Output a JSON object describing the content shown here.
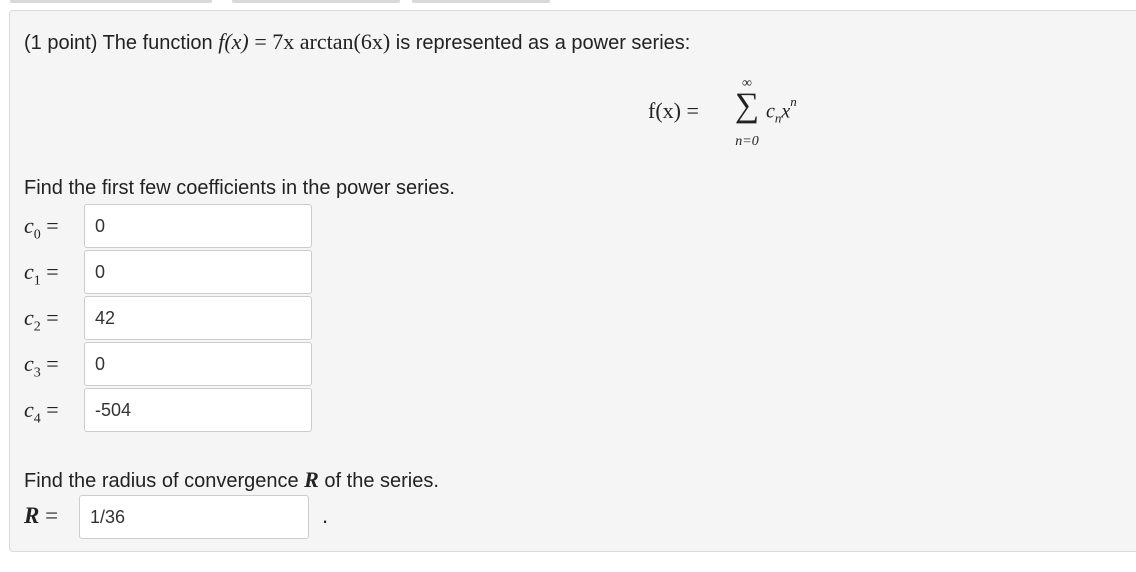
{
  "problem": {
    "points": "(1 point)",
    "intro": "The function",
    "function_lhs": "f(x)",
    "equals": "=",
    "function_rhs": "7x arctan(6x)",
    "outro": "is represented as a power series:"
  },
  "series": {
    "lhs": "f(x) =",
    "upper": "∞",
    "sigma": "∑",
    "lower": "n=0",
    "term_base": "c",
    "term_sub": "n",
    "term_var": "x",
    "term_sup": "n"
  },
  "coefficients_prompt": "Find the first few coefficients in the power series.",
  "coefficients": [
    {
      "symbol": "c",
      "index": "0",
      "equals": "=",
      "value": "0"
    },
    {
      "symbol": "c",
      "index": "1",
      "equals": "=",
      "value": "0"
    },
    {
      "symbol": "c",
      "index": "2",
      "equals": "=",
      "value": "42"
    },
    {
      "symbol": "c",
      "index": "3",
      "equals": "=",
      "value": "0"
    },
    {
      "symbol": "c",
      "index": "4",
      "equals": "=",
      "value": "-504"
    }
  ],
  "radius": {
    "prompt_before": "Find the radius of convergence",
    "prompt_symbol": "R",
    "prompt_after": "of the series.",
    "label": "R",
    "equals": "=",
    "value": "1/36",
    "trailing": "."
  },
  "colors": {
    "panel_background": "#f5f5f5",
    "panel_border": "#dadada",
    "input_border": "#cccccc",
    "text": "#222222"
  }
}
